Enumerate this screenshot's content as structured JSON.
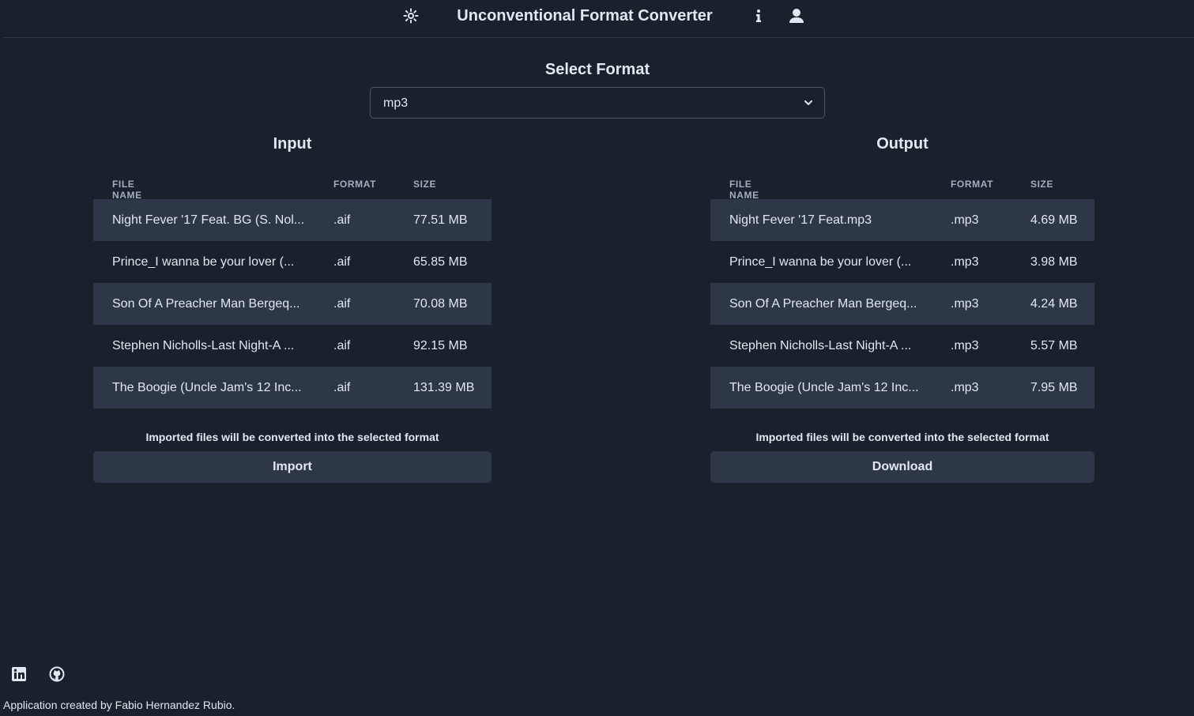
{
  "header": {
    "title": "Unconventional Format Converter",
    "icons": [
      "sun-icon",
      "info-icon",
      "user-icon"
    ]
  },
  "format": {
    "label": "Select Format",
    "selected": "mp3"
  },
  "input": {
    "title": "Input",
    "columns": [
      "FILE NAME",
      "FORMAT",
      "SIZE"
    ],
    "rows": [
      {
        "name": "Night Fever '17 Feat. BG (S. Nol...",
        "format": ".aif",
        "size": "77.51 MB"
      },
      {
        "name": "Prince_I wanna be your lover (...",
        "format": ".aif",
        "size": "65.85 MB"
      },
      {
        "name": "Son Of A Preacher Man Bergeq...",
        "format": ".aif",
        "size": "70.08 MB"
      },
      {
        "name": "Stephen Nicholls-Last Night-A ...",
        "format": ".aif",
        "size": "92.15 MB"
      },
      {
        "name": "The Boogie (Uncle Jam's 12 Inc...",
        "format": ".aif",
        "size": "131.39 MB"
      }
    ],
    "note": "Imported files will be converted into the selected format",
    "button": "Import"
  },
  "output": {
    "title": "Output",
    "columns": [
      "FILE NAME",
      "FORMAT",
      "SIZE"
    ],
    "rows": [
      {
        "name": "Night Fever '17 Feat.mp3",
        "format": ".mp3",
        "size": "4.69 MB"
      },
      {
        "name": "Prince_I wanna be your lover (...",
        "format": ".mp3",
        "size": "3.98 MB"
      },
      {
        "name": "Son Of A Preacher Man Bergeq...",
        "format": ".mp3",
        "size": "4.24 MB"
      },
      {
        "name": "Stephen Nicholls-Last Night-A ...",
        "format": ".mp3",
        "size": "5.57 MB"
      },
      {
        "name": "The Boogie (Uncle Jam's 12 Inc...",
        "format": ".mp3",
        "size": "7.95 MB"
      }
    ],
    "note": "Imported files will be converted into the selected format",
    "button": "Download"
  },
  "footer": {
    "icons": [
      "linkedin-icon",
      "github-icon"
    ],
    "credit": "Application created by Fabio Hernandez Rubio."
  },
  "colors": {
    "background": "#1a202c",
    "row_shade": "#2d3748",
    "text": "#e2e8f0",
    "muted": "#a0aec0"
  }
}
